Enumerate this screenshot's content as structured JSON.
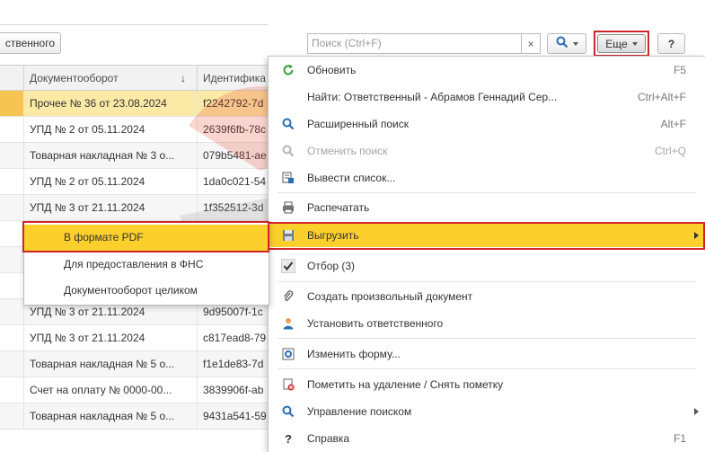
{
  "toolbar": {
    "responsible_button": "ственного",
    "search_placeholder": "Поиск (Ctrl+F)",
    "clear_label": "×",
    "more_label": "Еще",
    "help_label": "?"
  },
  "table": {
    "columns": [
      "",
      "Документооборот",
      "Идентифика"
    ],
    "sort_indicator": "↓",
    "rows": [
      {
        "doc": "Прочее № 36 от 23.08.2024",
        "id": "f2242792-7d"
      },
      {
        "doc": "УПД № 2 от 05.11.2024",
        "id": "2639f6fb-78c"
      },
      {
        "doc": "Товарная накладная № 3 о...",
        "id": "079b5481-ae"
      },
      {
        "doc": "УПД № 2 от 05.11.2024",
        "id": "1da0c021-54"
      },
      {
        "doc": "УПД № 3 от 21.11.2024",
        "id": "1f352512-3d"
      },
      {
        "doc": "",
        "id": ""
      },
      {
        "doc": "",
        "id": ""
      },
      {
        "doc": "",
        "id": ""
      },
      {
        "doc": "УПД № 3 от 21.11.2024",
        "id": "9d95007f-1c"
      },
      {
        "doc": "УПД № 3 от 21.11.2024",
        "id": "c817ead8-79"
      },
      {
        "doc": "Товарная накладная № 5 о...",
        "id": "f1e1de83-7d"
      },
      {
        "doc": "Счет на оплату № 0000-00...",
        "id": "3839906f-ab"
      },
      {
        "doc": "Товарная накладная № 5 о...",
        "id": "9431a541-59"
      }
    ]
  },
  "menu": {
    "items": [
      {
        "label": "Обновить",
        "shortcut": "F5",
        "icon": "refresh-icon"
      },
      {
        "label": "Найти: Ответственный - Абрамов Геннадий Сер...",
        "shortcut": "Ctrl+Alt+F",
        "icon": ""
      },
      {
        "label": "Расширенный поиск",
        "shortcut": "Alt+F",
        "icon": "search-icon"
      },
      {
        "label": "Отменить поиск",
        "shortcut": "Ctrl+Q",
        "icon": "cancel-search-icon"
      },
      {
        "label": "Вывести список...",
        "shortcut": "",
        "icon": "list-output-icon"
      },
      {
        "label": "Распечатать",
        "shortcut": "",
        "icon": "printer-icon"
      },
      {
        "label": "Выгрузить",
        "shortcut": "",
        "icon": "save-icon"
      },
      {
        "label": "Отбор (3)",
        "shortcut": "",
        "icon": "check-icon"
      },
      {
        "label": "Создать произвольный документ",
        "shortcut": "",
        "icon": "paperclip-icon"
      },
      {
        "label": "Установить ответственного",
        "shortcut": "",
        "icon": "user-icon"
      },
      {
        "label": "Изменить форму...",
        "shortcut": "",
        "icon": "form-settings-icon"
      },
      {
        "label": "Пометить на удаление / Снять пометку",
        "shortcut": "",
        "icon": "delete-mark-icon"
      },
      {
        "label": "Управление поиском",
        "shortcut": "",
        "icon": "search-manage-icon"
      },
      {
        "label": "Справка",
        "shortcut": "F1",
        "icon": "help-icon"
      }
    ]
  },
  "submenu": {
    "items": [
      "В формате PDF",
      "Для предоставления в ФНС",
      "Документооборот целиком"
    ]
  },
  "colors": {
    "highlight": "#fbd02c",
    "annotation_frame": "#d0262b",
    "selected_row": "#fbe9a6"
  }
}
